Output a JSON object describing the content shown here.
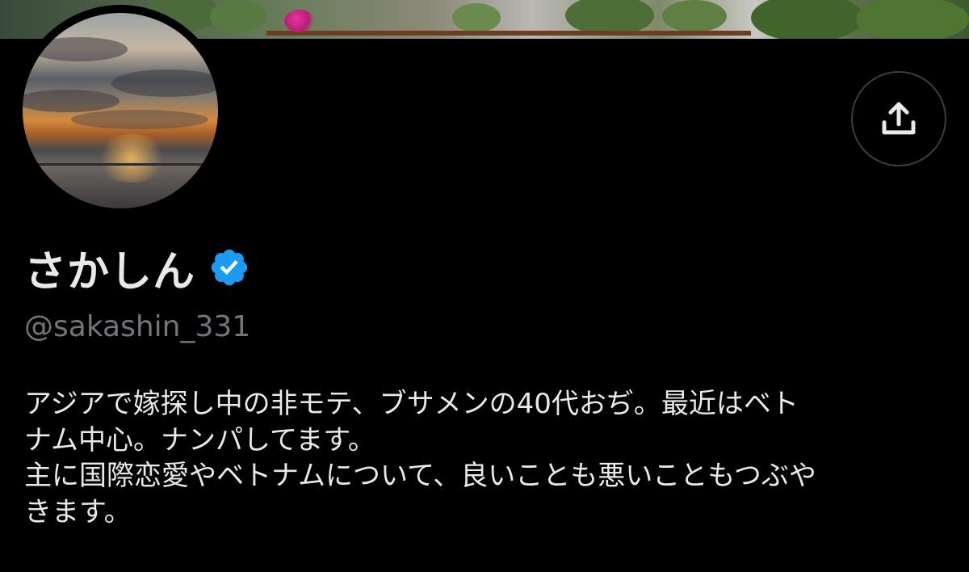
{
  "profile": {
    "display_name": "さかしん",
    "verified_icon": "verified-badge-icon",
    "handle": "@sakashin_331",
    "bio_lines": [
      "アジアで嫁探し中の非モテ、ブサメンの40代おぢ。最近はベト",
      "ナム中心。ナンパしてます。",
      "主に国際恋愛やベトナムについて、良いことも悪いこともつぶや",
      "きます。"
    ]
  },
  "actions": {
    "share_icon": "share-icon"
  },
  "colors": {
    "background": "#000000",
    "text_primary": "#e7e9ea",
    "text_secondary": "#71767b",
    "verified_blue": "#1d9bf0",
    "button_border": "#3a3d42"
  }
}
